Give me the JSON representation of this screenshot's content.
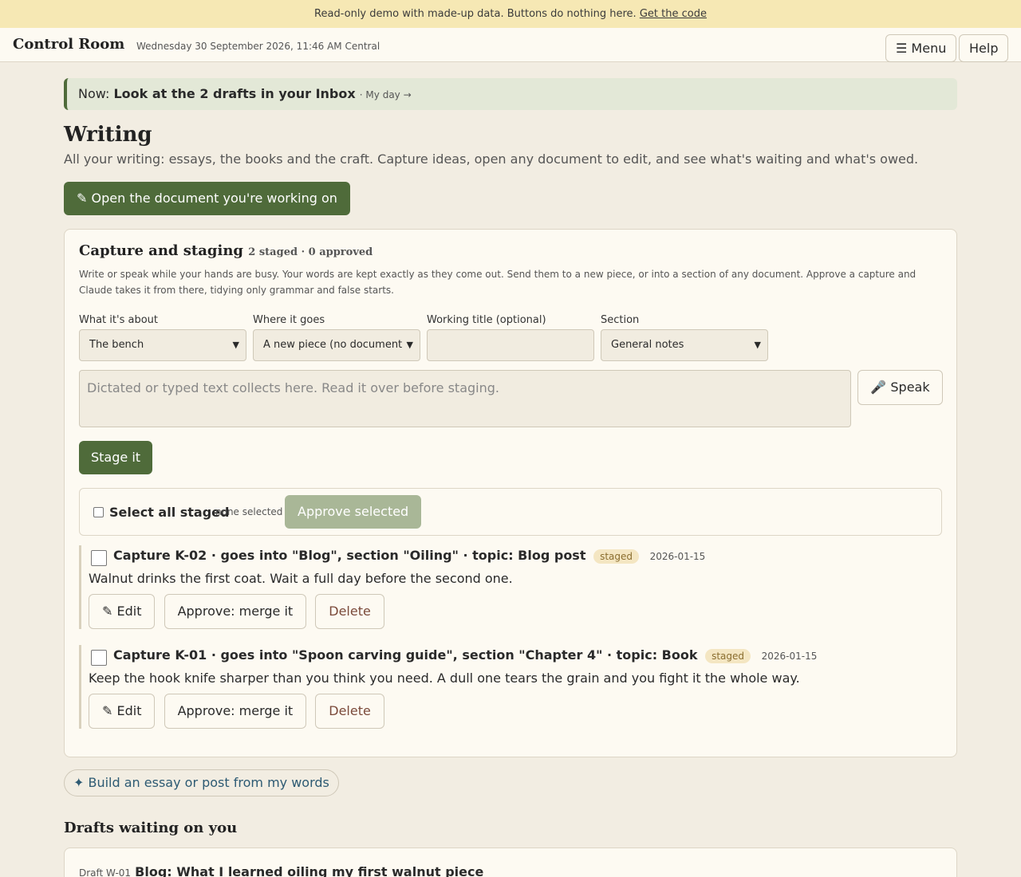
{
  "banner": {
    "text": "Read-only demo with made-up data. Buttons do nothing here.",
    "link": "Get the code"
  },
  "topbar": {
    "brand": "Control Room",
    "datetime": "Wednesday 30 September 2026, 11:46 AM Central",
    "menu": "☰ Menu",
    "help": "Help"
  },
  "now": {
    "prefix": "Now:",
    "message": "Look at the 2 drafts in your Inbox",
    "link": "· My day →"
  },
  "page": {
    "title": "Writing",
    "subtitle": "All your writing: essays, the books and the craft. Capture ideas, open any document to edit, and see what's waiting and what's owed.",
    "open_doc_button": "✎ Open the document you're working on"
  },
  "capture": {
    "title": "Capture and staging",
    "counts": "2 staged · 0 approved",
    "description": "Write or speak while your hands are busy. Your words are kept exactly as they come out. Send them to a new piece, or into a section of any document. Approve a capture and Claude takes it from there, tidying only grammar and false starts.",
    "fields": {
      "about_label": "What it's about",
      "about_value": "The bench",
      "where_label": "Where it goes",
      "where_value": "A new piece (no document",
      "title_label": "Working title (optional)",
      "title_value": "",
      "section_label": "Section",
      "section_value": "General notes"
    },
    "textarea_placeholder": "Dictated or typed text collects here. Read it over before staging.",
    "speak_button": "🎤 Speak",
    "stage_button": "Stage it",
    "select_all": "Select all staged",
    "none_selected": "none selected",
    "approve_selected": "Approve selected",
    "items": [
      {
        "title": "Capture K-02 · goes into \"Blog\", section \"Oiling\" · topic: Blog post",
        "status": "staged",
        "date": "2026-01-15",
        "text": "Walnut drinks the first coat. Wait a full day before the second one.",
        "edit": "✎ Edit",
        "approve": "Approve: merge it",
        "delete": "Delete"
      },
      {
        "title": "Capture K-01 · goes into \"Spoon carving guide\", section \"Chapter 4\" · topic: Book",
        "status": "staged",
        "date": "2026-01-15",
        "text": "Keep the hook knife sharper than you think you need. A dull one tears the grain and you fight it the whole way.",
        "edit": "✎ Edit",
        "approve": "Approve: merge it",
        "delete": "Delete"
      }
    ]
  },
  "build_button": "✦ Build an essay or post from my words",
  "drafts": {
    "heading": "Drafts waiting on you",
    "first": {
      "id": "Draft W-01",
      "title": "Blog: What I learned oiling my first walnut piece"
    }
  }
}
